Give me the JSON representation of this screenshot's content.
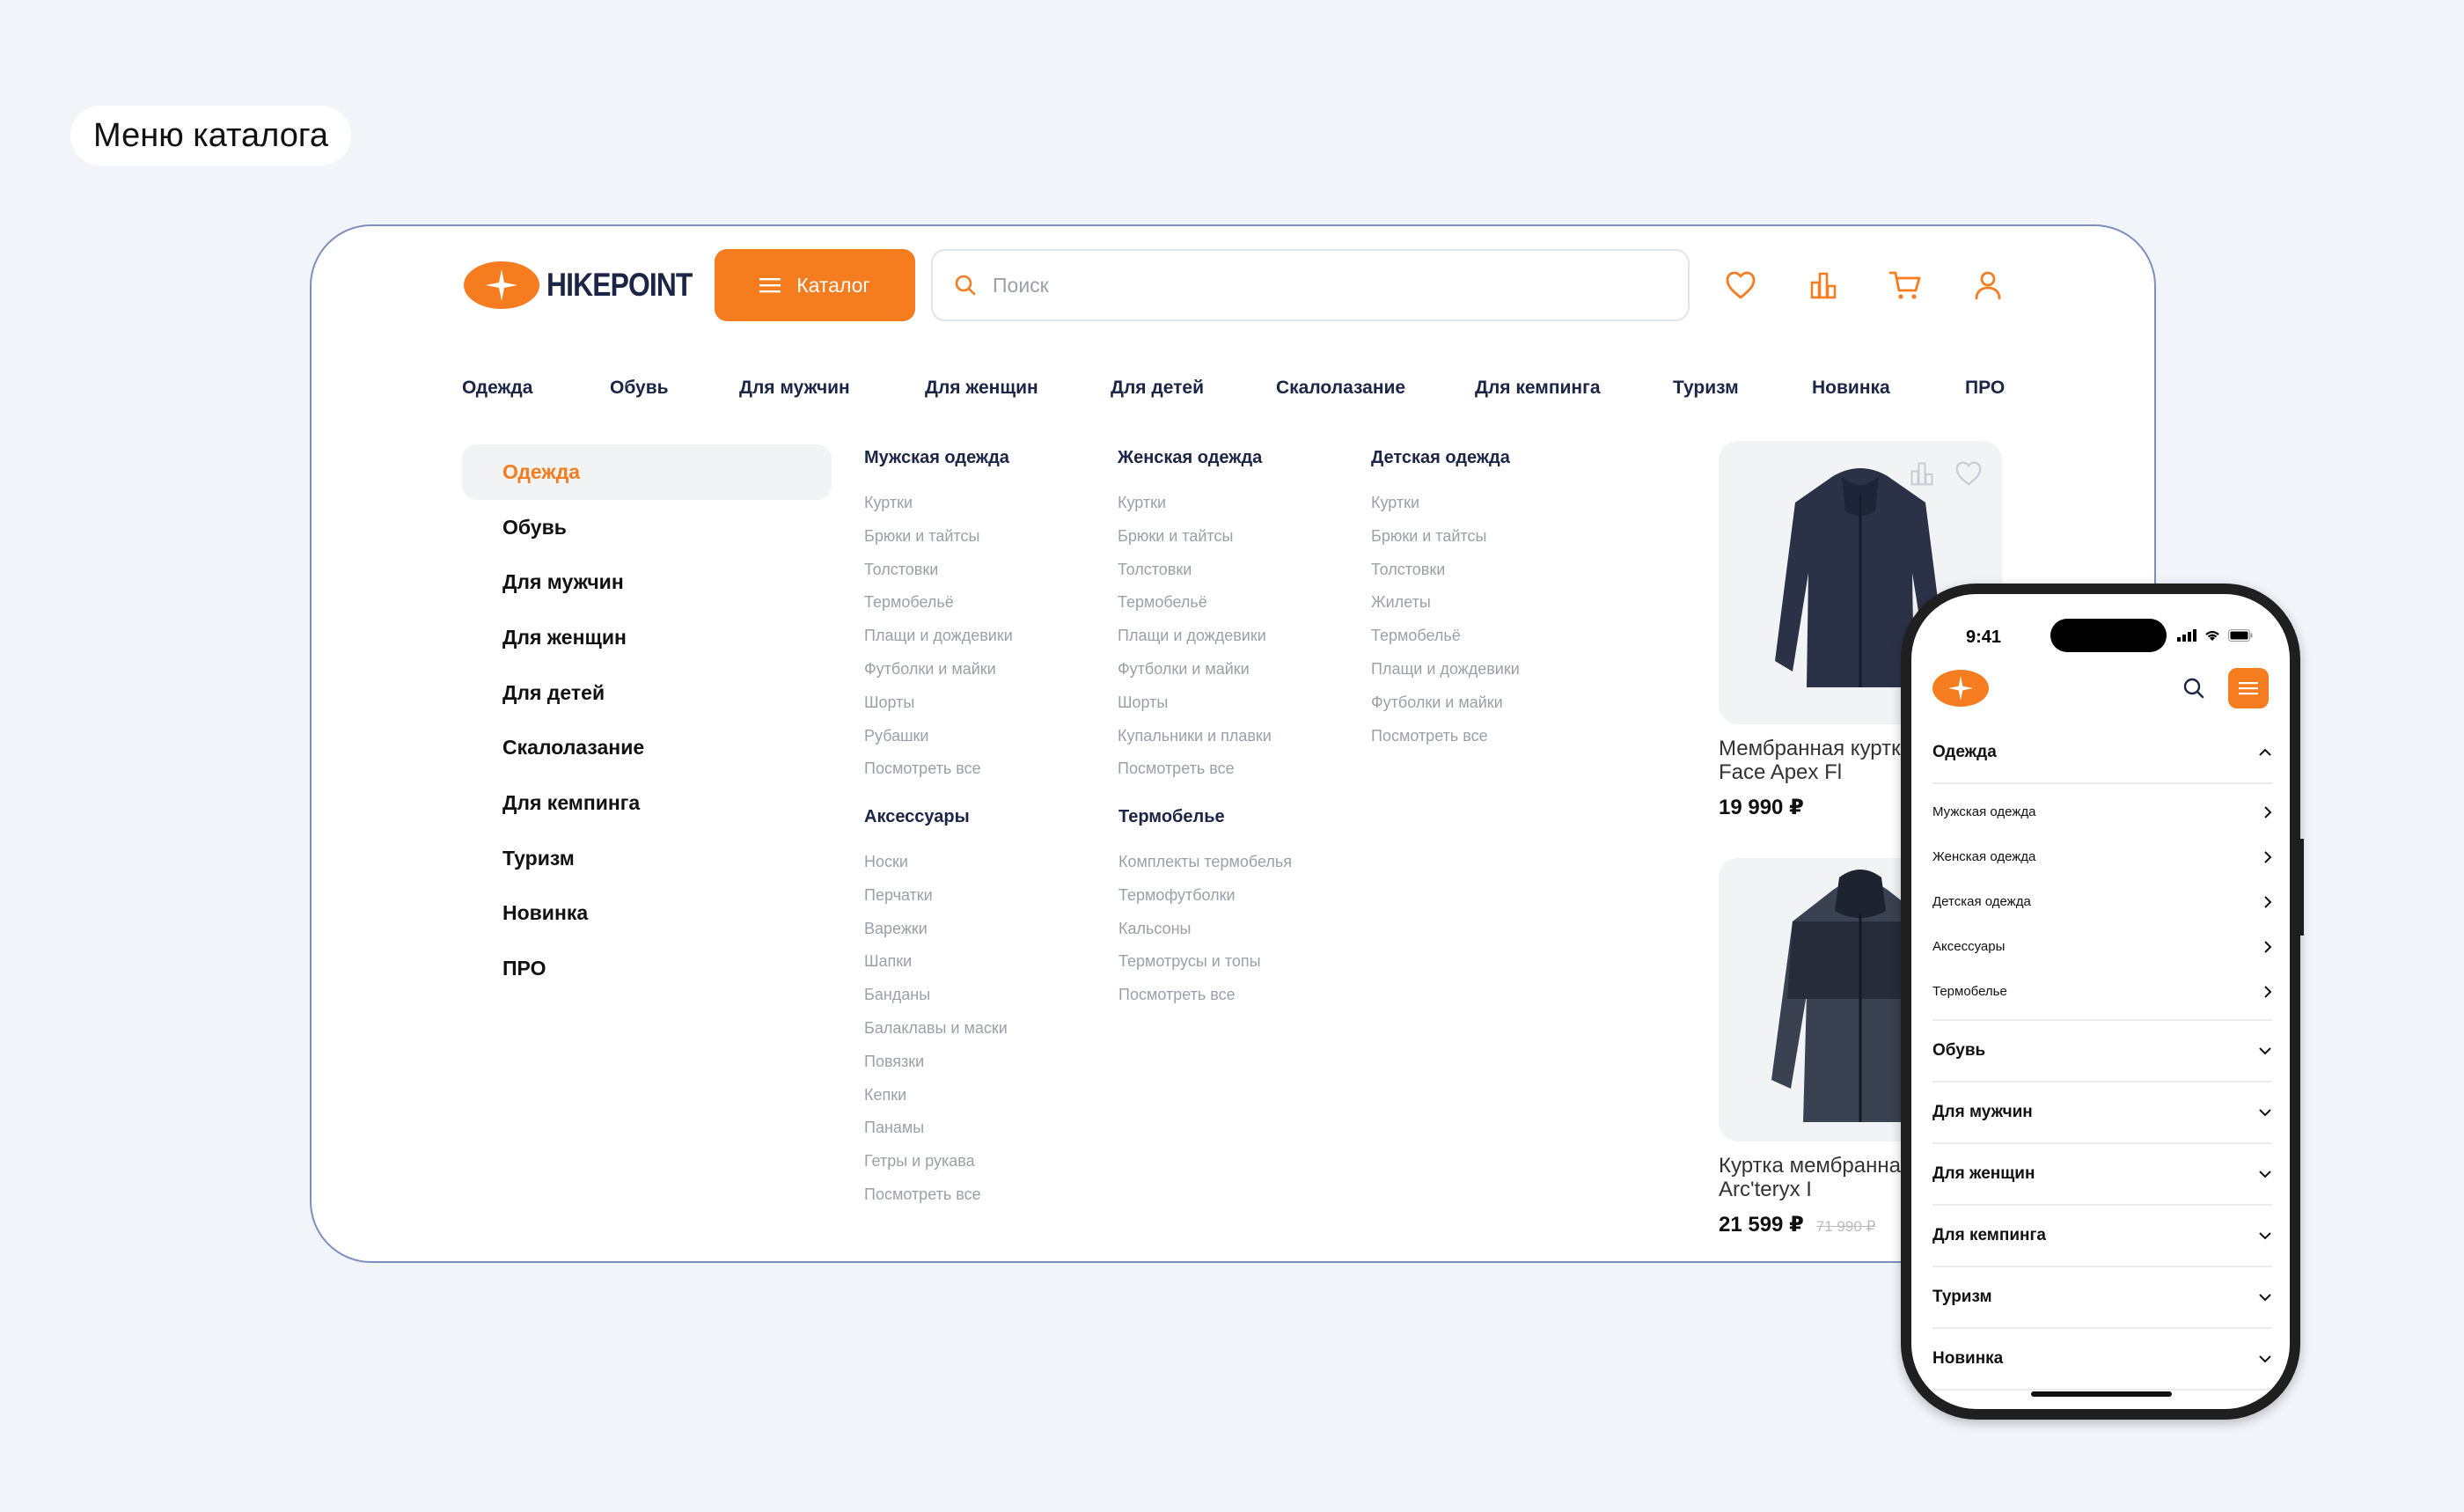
{
  "page_label": "Меню каталога",
  "brand": {
    "name": "HIKEPOINT",
    "accent": "#f57c1f",
    "dark": "#1b2546"
  },
  "header": {
    "catalog_label": "Каталог",
    "search_placeholder": "Поиск",
    "icons": [
      "heart-icon",
      "compare-icon",
      "cart-icon",
      "user-icon"
    ]
  },
  "topnav": [
    "Одежда",
    "Обувь",
    "Для мужчин",
    "Для женщин",
    "Для детей",
    "Скалолазание",
    "Для кемпинга",
    "Туризм",
    "Новинка",
    "ПРО"
  ],
  "sidebar": [
    "Одежда",
    "Обувь",
    "Для мужчин",
    "Для женщин",
    "Для детей",
    "Скалолазание",
    "Для кемпинга",
    "Туризм",
    "Новинка",
    "ПРО"
  ],
  "sidebar_active": "Одежда",
  "columns": [
    {
      "title": "Мужская одежда",
      "links": [
        "Куртки",
        "Брюки и тайтсы",
        "Толстовки",
        "Термобельё",
        "Плащи и дождевики",
        "Футболки и майки",
        "Шорты",
        "Рубашки",
        "Посмотреть все"
      ]
    },
    {
      "title": "Женская одежда",
      "links": [
        "Куртки",
        "Брюки и тайтсы",
        "Толстовки",
        "Термобельё",
        "Плащи и дождевики",
        "Футболки и майки",
        "Шорты",
        "Купальники и плавки",
        "Посмотреть все"
      ]
    },
    {
      "title": "Детская одежда",
      "links": [
        "Куртки",
        "Брюки и тайтсы",
        "Толстовки",
        "Жилеты",
        "Термобельё",
        "Плащи и дождевики",
        "Футболки и майки",
        "Посмотреть все"
      ]
    },
    {
      "title": "Аксессуары",
      "links": [
        "Носки",
        "Перчатки",
        "Варежки",
        "Шапки",
        "Банданы",
        "Балаклавы и маски",
        "Повязки",
        "Кепки",
        "Панамы",
        "Гетры и рукава",
        "Посмотреть все"
      ]
    },
    {
      "title": "Термобелье",
      "links": [
        "Комплекты термобелья",
        "Термофутболки",
        "Кальсоны",
        "Термотрусы и топы",
        "Посмотреть все"
      ]
    }
  ],
  "products": [
    {
      "name": "Мембранная куртк North Face Apex Fl",
      "price": "19 990 ₽",
      "old_price": ""
    },
    {
      "name": "Куртка мембранна мужская Arc'teryx I",
      "price": "21 599 ₽",
      "old_price": "71 990 ₽"
    }
  ],
  "mobile": {
    "time": "9:41",
    "expanded": {
      "label": "Одежда",
      "items": [
        "Мужская одежда",
        "Женская одежда",
        "Детская одежда",
        "Аксессуары",
        "Термобелье"
      ]
    },
    "collapsed": [
      "Обувь",
      "Для мужчин",
      "Для женщин",
      "Для кемпинга",
      "Туризм",
      "Новинка"
    ]
  }
}
